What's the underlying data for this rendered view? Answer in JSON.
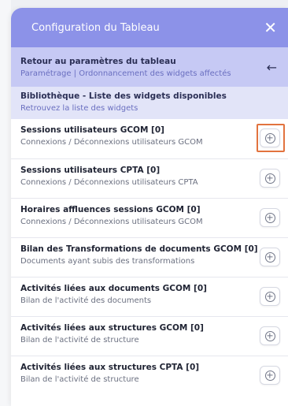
{
  "header": {
    "title": "Configuration du Tableau",
    "close_icon": "close-icon"
  },
  "back": {
    "title": "Retour au paramètres du tableau",
    "subtitle": "Paramétrage | Ordonnancement des widgets affectés",
    "icon": "arrow-left-icon"
  },
  "library": {
    "title": "Bibliothèque - Liste des widgets disponibles",
    "subtitle": "Retrouvez la liste des widgets"
  },
  "widgets": [
    {
      "title": "Sessions utilisateurs GCOM   [0]",
      "subtitle": "Connexions / Déconnexions utilisateurs GCOM",
      "highlighted": true
    },
    {
      "title": "Sessions utilisateurs CPTA   [0]",
      "subtitle": "Connexions / Déconnexions utilisateurs CPTA",
      "highlighted": false
    },
    {
      "title": "Horaires affluences sessions GCOM   [0]",
      "subtitle": "Connexions / Déconnexions utilisateurs GCOM",
      "highlighted": false
    },
    {
      "title": "Bilan des Transformations de documents GCOM   [0]",
      "subtitle": "Documents ayant subis des transformations",
      "highlighted": false
    },
    {
      "title": "Activités liées aux documents GCOM   [0]",
      "subtitle": "Bilan de l'activité des documents",
      "highlighted": false
    },
    {
      "title": "Activités liées aux structures GCOM   [0]",
      "subtitle": "Bilan de l'activité de structure",
      "highlighted": false
    },
    {
      "title": "Activités liées aux structures CPTA   [0]",
      "subtitle": "Bilan de l'activité de structure",
      "highlighted": false
    }
  ],
  "colors": {
    "header": "#8c92e8",
    "back_row": "#c6c9f4",
    "library_row": "#e2e4f8",
    "highlight": "#e2733e"
  },
  "add_icon": "plus-circle-icon"
}
